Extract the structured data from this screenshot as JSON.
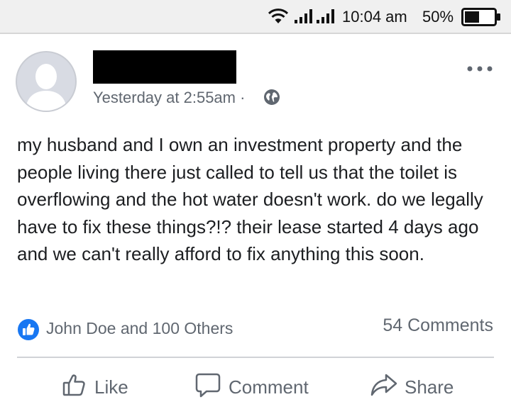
{
  "status_bar": {
    "time": "10:04 am",
    "battery": "50%",
    "battery_level": 0.5,
    "icons": [
      "wifi-icon",
      "signal-icon",
      "signal-icon",
      "battery-icon"
    ]
  },
  "post": {
    "timestamp": "Yesterday at 2:55am",
    "separator": "·",
    "audience_icon": "globe-icon",
    "text": "my husband and I own an investment property and the people living there just called to tell us that the toilet is overflowing and the hot water doesn't work. do we legally have to fix these things?!? their lease started 4 days ago and we can't really afford to fix anything this soon."
  },
  "engagement": {
    "reactions_text": "John Doe and 100 Others",
    "comments_text": "54 Comments"
  },
  "actions": {
    "like": "Like",
    "comment": "Comment",
    "share": "Share"
  },
  "colors": {
    "facebook_blue": "#1877f2",
    "secondary_text": "#606770",
    "primary_text": "#1c1e21",
    "avatar_bg": "#d8dbe3"
  }
}
